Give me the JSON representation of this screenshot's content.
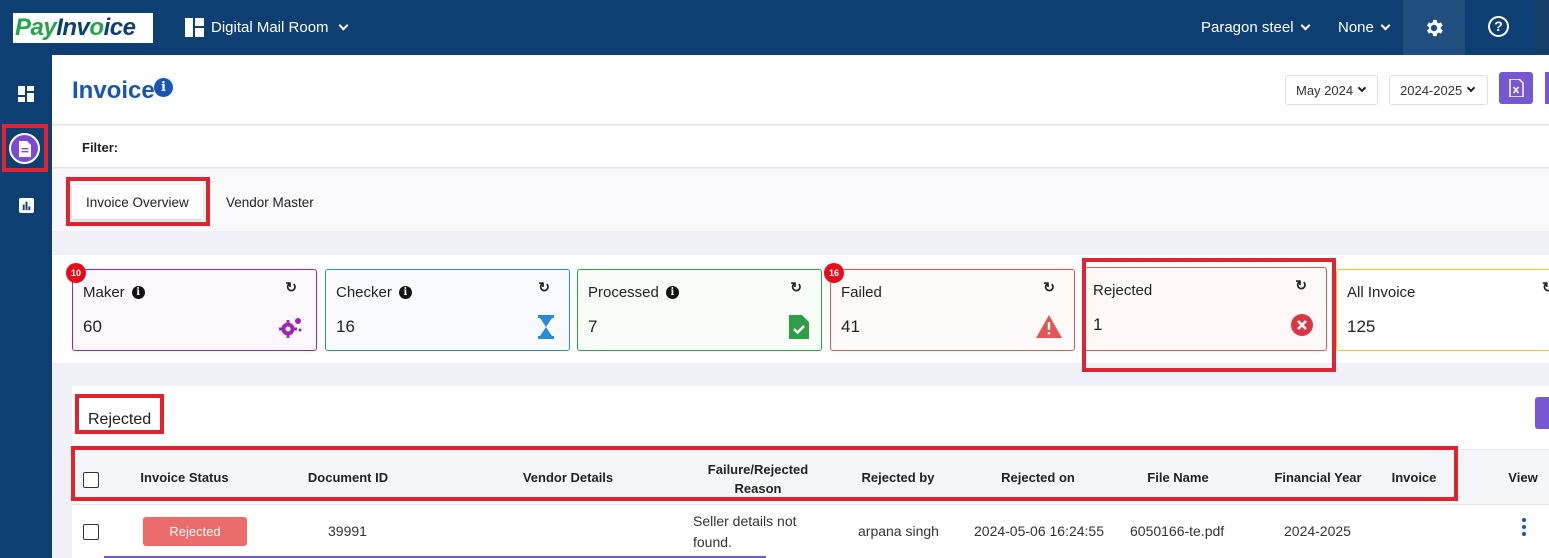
{
  "app": {
    "logo_pay": "Pay",
    "logo_inv": "Inv",
    "logo_o": "o",
    "logo_rest": "ice",
    "module": "Digital Mail Room",
    "organization": "Paragon steel",
    "selector": "None"
  },
  "page": {
    "title": "Invoice",
    "month": "May 2024",
    "year": "2024-2025",
    "filter_label": "Filter:"
  },
  "tabs": [
    {
      "label": "Invoice Overview",
      "active": true
    },
    {
      "label": "Vendor Master",
      "active": false
    }
  ],
  "cards": [
    {
      "label": "Maker",
      "value": "60",
      "badge": "10",
      "border": "#9c27b0",
      "bg": "#fdf8fe"
    },
    {
      "label": "Checker",
      "value": "16",
      "border": "#2b8ad6",
      "bg": "#f7fbff"
    },
    {
      "label": "Processed",
      "value": "7",
      "border": "#2e9d46",
      "bg": "#f7fcf7"
    },
    {
      "label": "Failed",
      "value": "41",
      "badge": "16",
      "border": "#e45555",
      "bg": "#fffafa"
    },
    {
      "label": "Rejected",
      "value": "1",
      "border": "#e45555",
      "bg": "#fff8f8"
    },
    {
      "label": "All Invoice",
      "value": "125",
      "border": "#f2c230",
      "bg": "#ffffff"
    }
  ],
  "table": {
    "section_title": "Rejected",
    "headers": {
      "invoice_status": "Invoice Status",
      "document_id": "Document ID",
      "vendor_details": "Vendor Details",
      "failure_reason_1": "Failure/Rejected",
      "failure_reason_2": "Reason",
      "rejected_by": "Rejected by",
      "rejected_on": "Rejected on",
      "file_name": "File Name",
      "financial_year": "Financial Year",
      "invoice": "Invoice",
      "view": "View"
    },
    "rows": [
      {
        "status": "Rejected",
        "document_id": "39991",
        "vendor_details": "",
        "reason_1": "Seller details not",
        "reason_2": "found.",
        "rejected_by": "arpana singh",
        "rejected_on": "2024-05-06 16:24:55",
        "file_name": "6050166-te.pdf",
        "financial_year": "2024-2025",
        "invoice": ""
      }
    ]
  },
  "colors": {
    "brand": "#0d3f73",
    "accent": "#7757d1",
    "title": "#1757b0",
    "highlight": "#e0232e"
  },
  "icons": [
    "dashboard-icon",
    "document-icon",
    "chart-icon",
    "gear-icon",
    "help-icon",
    "excel-icon",
    "gears-icon",
    "hourglass-icon",
    "file-check-icon",
    "warning-icon",
    "close-circle-icon",
    "refresh-icon",
    "info-icon",
    "kebab-icon"
  ]
}
